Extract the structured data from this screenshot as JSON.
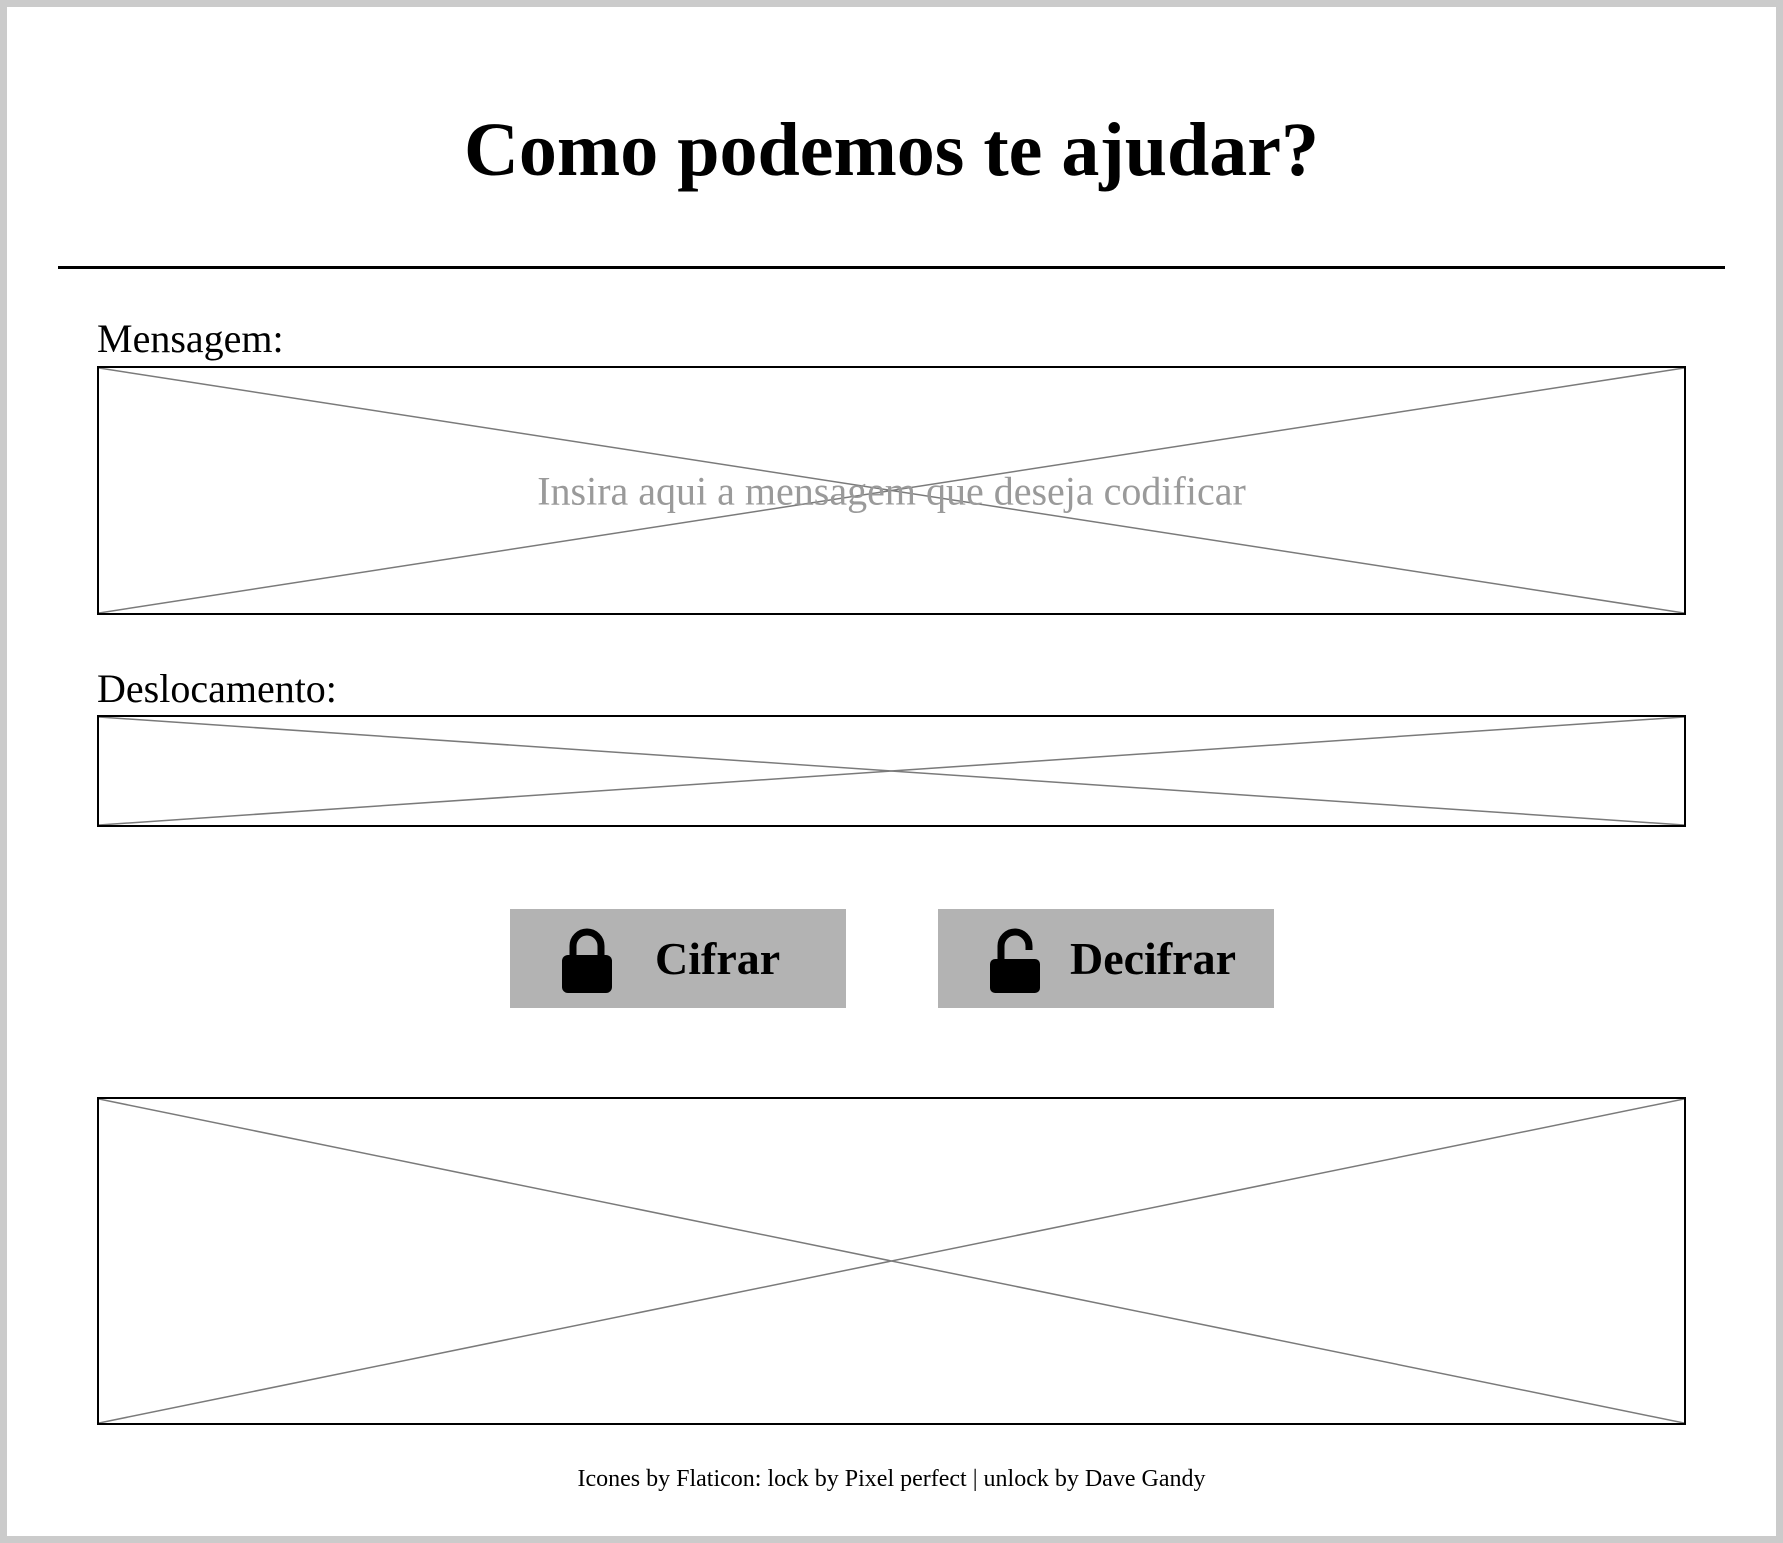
{
  "header": {
    "title": "Como podemos te ajudar?"
  },
  "form": {
    "message_label": "Mensagem:",
    "message_placeholder": "Insira aqui a mensagem que deseja codificar",
    "shift_label": "Deslocamento:"
  },
  "actions": {
    "encrypt_label": "Cifrar",
    "encrypt_icon": "lock-icon",
    "decrypt_label": "Decifrar",
    "decrypt_icon": "unlock-icon"
  },
  "footer": {
    "credits": "Icones by Flaticon: lock by Pixel perfect | unlock by Dave Gandy"
  },
  "colors": {
    "button_background": "#b3b3b3",
    "placeholder_text": "#9a9a9a",
    "frame_border": "#cbcbcb"
  }
}
